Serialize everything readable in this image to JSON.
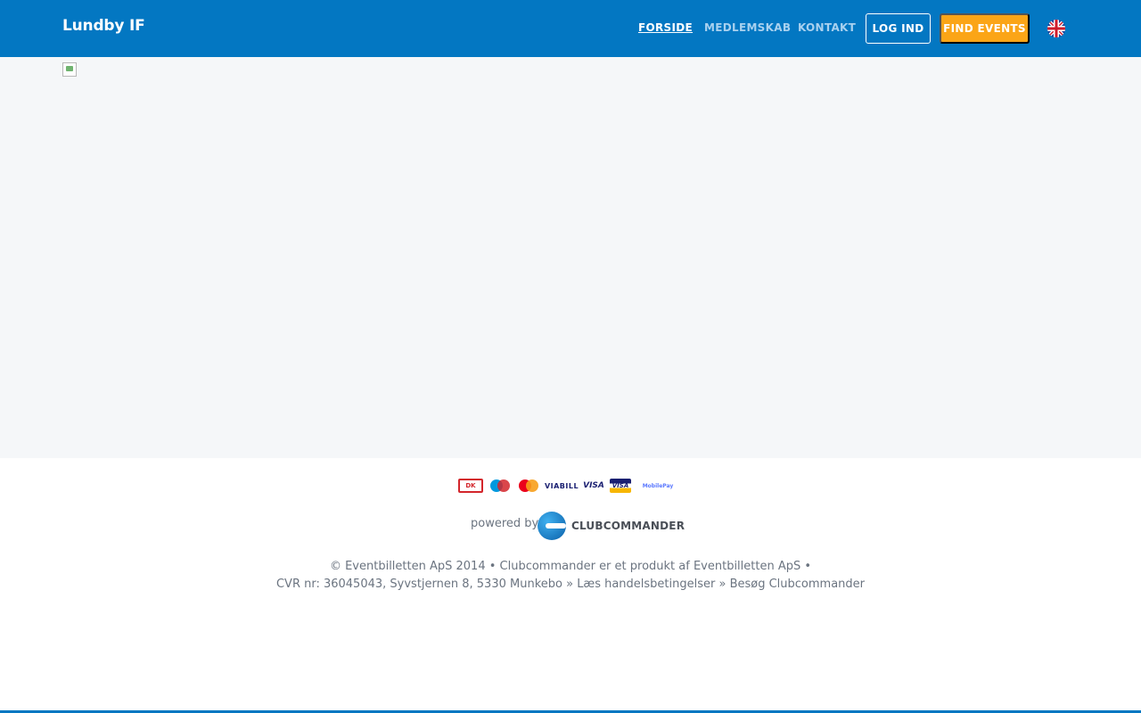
{
  "brand": {
    "name": "Lundby IF"
  },
  "nav": {
    "items": [
      {
        "label": "FORSIDE",
        "active": true
      },
      {
        "label": "MEDLEMSKAB",
        "active": false
      },
      {
        "label": "KONTAKT",
        "active": false
      }
    ],
    "login_label": "LOG IND",
    "find_events_label": "FIND EVENTS",
    "language_icon": "uk-flag-icon"
  },
  "colors": {
    "primary": "#0377c2",
    "accent": "#fba517",
    "main_bg": "#f5f7f9",
    "text_muted": "#6b7480"
  },
  "footer": {
    "payment_methods": [
      {
        "name": "dankort",
        "label": "DK"
      },
      {
        "name": "maestro",
        "label": ""
      },
      {
        "name": "mastercard",
        "label": ""
      },
      {
        "name": "viabill",
        "label": "VIABILL"
      },
      {
        "name": "visa",
        "label": "VISA"
      },
      {
        "name": "visa-electron",
        "label": "VISA"
      },
      {
        "name": "mobilepay",
        "label": "MobilePay"
      }
    ],
    "powered_by": "powered by",
    "logo_text": "CLUBCOMMANDER",
    "line1": "© Eventbilletten ApS 2014 • Clubcommander er et produkt af Eventbilletten ApS •",
    "line2_address": "CVR nr: 36045043, Syvstjernen 8, 5330 Munkebo",
    "line2_sep1": " » ",
    "terms_link": "Læs handelsbetingelser",
    "line2_sep2": " » ",
    "visit_link": "Besøg Clubcommander"
  }
}
